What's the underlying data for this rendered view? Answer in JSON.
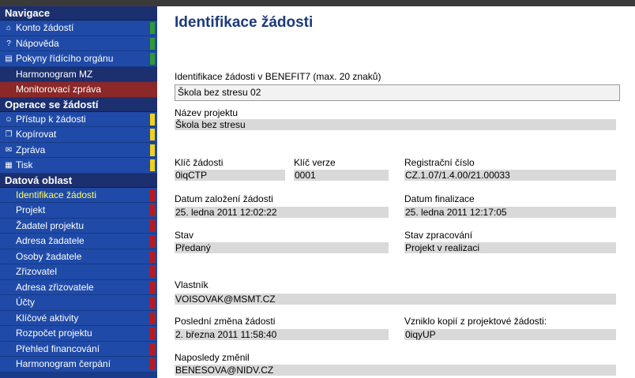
{
  "sidebar": {
    "sections": [
      {
        "title": "Navigace",
        "items": [
          {
            "label": "Konto žádostí",
            "icon": "home-icon",
            "marker": "green"
          },
          {
            "label": "Nápověda",
            "icon": "help-icon",
            "marker": "green"
          },
          {
            "label": "Pokyny řídícího orgánu",
            "icon": "book-icon",
            "marker": "green"
          },
          {
            "label": "Harmonogram MZ",
            "icon": "",
            "marker": "none"
          },
          {
            "label": "Monitorovací zpráva",
            "icon": "",
            "marker": "none",
            "highlight": "red"
          }
        ]
      },
      {
        "title": "Operace se žádostí",
        "items": [
          {
            "label": "Přístup k žádosti",
            "icon": "user-icon",
            "marker": "yellow"
          },
          {
            "label": "Kopírovat",
            "icon": "copy-icon",
            "marker": "yellow"
          },
          {
            "label": "Zpráva",
            "icon": "mail-icon",
            "marker": "yellow"
          },
          {
            "label": "Tisk",
            "icon": "print-icon",
            "marker": "yellow"
          }
        ]
      },
      {
        "title": "Datová oblast",
        "items": [
          {
            "label": "Identifikace žádosti",
            "icon": "",
            "marker": "red",
            "active": true
          },
          {
            "label": "Projekt",
            "icon": "",
            "marker": "red"
          },
          {
            "label": "Žadatel projektu",
            "icon": "",
            "marker": "red"
          },
          {
            "label": "Adresa žadatele",
            "icon": "",
            "marker": "red"
          },
          {
            "label": "Osoby žadatele",
            "icon": "",
            "marker": "red"
          },
          {
            "label": "Zřizovatel",
            "icon": "",
            "marker": "red"
          },
          {
            "label": "Adresa zřizovatele",
            "icon": "",
            "marker": "red"
          },
          {
            "label": "Účty",
            "icon": "",
            "marker": "red"
          },
          {
            "label": "Klíčové aktivity",
            "icon": "",
            "marker": "red"
          },
          {
            "label": "Rozpočet projektu",
            "icon": "",
            "marker": "red"
          },
          {
            "label": "Přehled financování",
            "icon": "",
            "marker": "red"
          },
          {
            "label": "Harmonogram čerpání",
            "icon": "",
            "marker": "red"
          }
        ]
      }
    ]
  },
  "main": {
    "title": "Identifikace žádosti",
    "identifikace_label": "Identifikace žádosti v BENEFIT7 (max. 20 znaků)",
    "identifikace_value": "Škola bez stresu 02",
    "nazev_label": "Název projektu",
    "nazev_value": "Škola bez stresu",
    "klic_zadosti_label": "Klíč žádosti",
    "klic_zadosti_value": "0iqCTP",
    "klic_verze_label": "Klíč verze",
    "klic_verze_value": "0001",
    "registracni_label": "Registrační číslo",
    "registracni_value": "CZ.1.07/1.4.00/21.00033",
    "datum_zalozeni_label": "Datum založení žádosti",
    "datum_zalozeni_value": "25. ledna 2011 12:02:22",
    "datum_finalizace_label": "Datum finalizace",
    "datum_finalizace_value": "25. ledna 2011 12:17:05",
    "stav_label": "Stav",
    "stav_value": "Předaný",
    "stav_zpracovani_label": "Stav zpracování",
    "stav_zpracovani_value": "Projekt v realizaci",
    "vlastnik_label": "Vlastník",
    "vlastnik_value": "VOISOVAK@MSMT.CZ",
    "posledni_zmena_label": "Poslední změna žádosti",
    "posledni_zmena_value": "2. března 2011 11:58:40",
    "vzniklo_kopii_label": "Vzniklo kopií z projektové žádosti:",
    "vzniklo_kopii_value": "0iqyUP",
    "naposledy_zmenil_label": "Naposledy změnil",
    "naposledy_zmenil_value": "BENESOVA@NIDV.CZ"
  },
  "colors": {
    "sidebar_bg": "#1f4aa8",
    "section_bg": "#1c2f6e",
    "title": "#1c3a7e",
    "field_bg": "#d9d9d9",
    "marker_green": "#2f9a34",
    "marker_yellow": "#f2d11c",
    "marker_red": "#c01818"
  }
}
